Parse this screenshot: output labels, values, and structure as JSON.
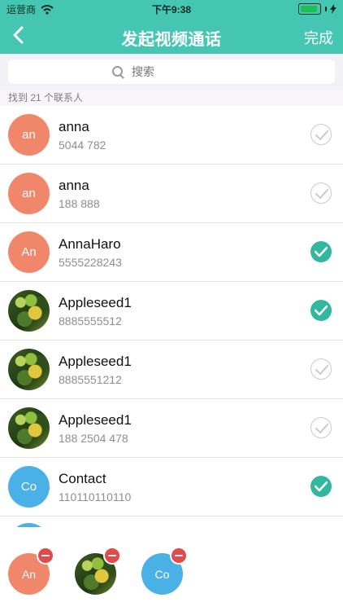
{
  "status": {
    "carrier": "运营商",
    "time": "下午9:38",
    "battery_color": "#1fbf4f"
  },
  "nav": {
    "title": "发起视频通话",
    "done_label": "完成",
    "back_icon": "chevron-left-icon"
  },
  "search": {
    "placeholder": "搜索"
  },
  "found_text": "找到 21 个联系人",
  "contacts": [
    {
      "name": "anna",
      "phone": "5044 782",
      "avatar_text": "an",
      "avatar_type": "salmon",
      "checked": false
    },
    {
      "name": "anna",
      "phone": "188 888",
      "avatar_text": "an",
      "avatar_type": "salmon",
      "checked": false
    },
    {
      "name": "AnnaHaro",
      "phone": "5555228243",
      "avatar_text": "An",
      "avatar_type": "salmon",
      "checked": true
    },
    {
      "name": "Appleseed1",
      "phone": "8885555512",
      "avatar_text": "",
      "avatar_type": "photo",
      "checked": true
    },
    {
      "name": "Appleseed1",
      "phone": "8885551212",
      "avatar_text": "",
      "avatar_type": "photo",
      "checked": false
    },
    {
      "name": "Appleseed1",
      "phone": "188 2504 478",
      "avatar_text": "",
      "avatar_type": "photo",
      "checked": false
    },
    {
      "name": "Contact",
      "phone": "110110110110",
      "avatar_text": "Co",
      "avatar_type": "blue",
      "checked": true
    }
  ],
  "selected": [
    {
      "avatar_text": "An",
      "avatar_type": "salmon"
    },
    {
      "avatar_text": "",
      "avatar_type": "photo"
    },
    {
      "avatar_text": "Co",
      "avatar_type": "blue"
    }
  ],
  "colors": {
    "accent": "#45c6b3",
    "check": "#33b8a0",
    "remove": "#e24b4b"
  }
}
